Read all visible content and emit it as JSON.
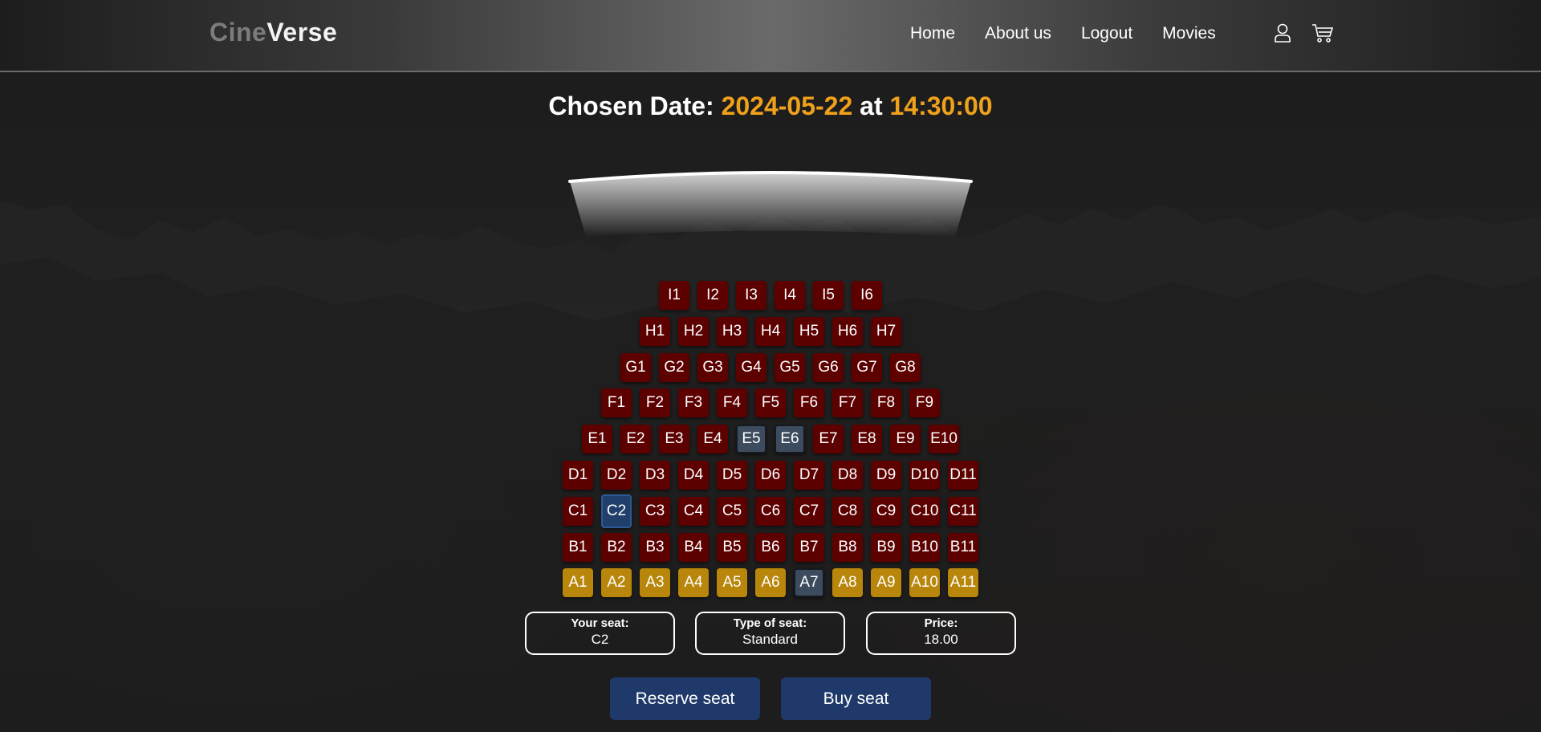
{
  "app": {
    "logo_part1": "Cine",
    "logo_part2": "Verse"
  },
  "nav": {
    "items": [
      "Home",
      "About us",
      "Logout",
      "Movies"
    ],
    "icons": [
      "user-icon",
      "cart-icon"
    ]
  },
  "heading": {
    "prefix": "Chosen Date:",
    "date": "2024-05-22",
    "connector": "at",
    "time": "14:30:00"
  },
  "colors": {
    "accent": "#f0a11a",
    "seat_available": "#5c0000",
    "seat_premium": "#b8860b",
    "seat_taken": "#3d4b5e",
    "seat_selected": "#203f6a",
    "button": "#1f3a6a"
  },
  "seating": {
    "rows": [
      {
        "row": "I",
        "seats": [
          {
            "label": "I1",
            "status": "available"
          },
          {
            "label": "I2",
            "status": "available"
          },
          {
            "label": "I3",
            "status": "available"
          },
          {
            "label": "I4",
            "status": "available"
          },
          {
            "label": "I5",
            "status": "available"
          },
          {
            "label": "I6",
            "status": "available"
          }
        ]
      },
      {
        "row": "H",
        "seats": [
          {
            "label": "H1",
            "status": "available"
          },
          {
            "label": "H2",
            "status": "available"
          },
          {
            "label": "H3",
            "status": "available"
          },
          {
            "label": "H4",
            "status": "available"
          },
          {
            "label": "H5",
            "status": "available"
          },
          {
            "label": "H6",
            "status": "available"
          },
          {
            "label": "H7",
            "status": "available"
          }
        ]
      },
      {
        "row": "G",
        "seats": [
          {
            "label": "G1",
            "status": "available"
          },
          {
            "label": "G2",
            "status": "available"
          },
          {
            "label": "G3",
            "status": "available"
          },
          {
            "label": "G4",
            "status": "available"
          },
          {
            "label": "G5",
            "status": "available"
          },
          {
            "label": "G6",
            "status": "available"
          },
          {
            "label": "G7",
            "status": "available"
          },
          {
            "label": "G8",
            "status": "available"
          }
        ]
      },
      {
        "row": "F",
        "seats": [
          {
            "label": "F1",
            "status": "available"
          },
          {
            "label": "F2",
            "status": "available"
          },
          {
            "label": "F3",
            "status": "available"
          },
          {
            "label": "F4",
            "status": "available"
          },
          {
            "label": "F5",
            "status": "available"
          },
          {
            "label": "F6",
            "status": "available"
          },
          {
            "label": "F7",
            "status": "available"
          },
          {
            "label": "F8",
            "status": "available"
          },
          {
            "label": "F9",
            "status": "available"
          }
        ]
      },
      {
        "row": "E",
        "seats": [
          {
            "label": "E1",
            "status": "available"
          },
          {
            "label": "E2",
            "status": "available"
          },
          {
            "label": "E3",
            "status": "available"
          },
          {
            "label": "E4",
            "status": "available"
          },
          {
            "label": "E5",
            "status": "taken"
          },
          {
            "label": "E6",
            "status": "taken"
          },
          {
            "label": "E7",
            "status": "available"
          },
          {
            "label": "E8",
            "status": "available"
          },
          {
            "label": "E9",
            "status": "available"
          },
          {
            "label": "E10",
            "status": "available"
          }
        ]
      },
      {
        "row": "D",
        "seats": [
          {
            "label": "D1",
            "status": "available"
          },
          {
            "label": "D2",
            "status": "available"
          },
          {
            "label": "D3",
            "status": "available"
          },
          {
            "label": "D4",
            "status": "available"
          },
          {
            "label": "D5",
            "status": "available"
          },
          {
            "label": "D6",
            "status": "available"
          },
          {
            "label": "D7",
            "status": "available"
          },
          {
            "label": "D8",
            "status": "available"
          },
          {
            "label": "D9",
            "status": "available"
          },
          {
            "label": "D10",
            "status": "available"
          },
          {
            "label": "D11",
            "status": "available"
          }
        ]
      },
      {
        "row": "C",
        "seats": [
          {
            "label": "C1",
            "status": "available"
          },
          {
            "label": "C2",
            "status": "selected"
          },
          {
            "label": "C3",
            "status": "available"
          },
          {
            "label": "C4",
            "status": "available"
          },
          {
            "label": "C5",
            "status": "available"
          },
          {
            "label": "C6",
            "status": "available"
          },
          {
            "label": "C7",
            "status": "available"
          },
          {
            "label": "C8",
            "status": "available"
          },
          {
            "label": "C9",
            "status": "available"
          },
          {
            "label": "C10",
            "status": "available"
          },
          {
            "label": "C11",
            "status": "available"
          }
        ]
      },
      {
        "row": "B",
        "seats": [
          {
            "label": "B1",
            "status": "available"
          },
          {
            "label": "B2",
            "status": "available"
          },
          {
            "label": "B3",
            "status": "available"
          },
          {
            "label": "B4",
            "status": "available"
          },
          {
            "label": "B5",
            "status": "available"
          },
          {
            "label": "B6",
            "status": "available"
          },
          {
            "label": "B7",
            "status": "available"
          },
          {
            "label": "B8",
            "status": "available"
          },
          {
            "label": "B9",
            "status": "available"
          },
          {
            "label": "B10",
            "status": "available"
          },
          {
            "label": "B11",
            "status": "available"
          }
        ]
      },
      {
        "row": "A",
        "seats": [
          {
            "label": "A1",
            "status": "premium"
          },
          {
            "label": "A2",
            "status": "premium"
          },
          {
            "label": "A3",
            "status": "premium"
          },
          {
            "label": "A4",
            "status": "premium"
          },
          {
            "label": "A5",
            "status": "premium"
          },
          {
            "label": "A6",
            "status": "premium"
          },
          {
            "label": "A7",
            "status": "taken"
          },
          {
            "label": "A8",
            "status": "premium"
          },
          {
            "label": "A9",
            "status": "premium"
          },
          {
            "label": "A10",
            "status": "premium"
          },
          {
            "label": "A11",
            "status": "premium"
          }
        ]
      }
    ]
  },
  "summary": {
    "seat_label": "Your seat:",
    "seat_value": "C2",
    "type_label": "Type of seat:",
    "type_value": "Standard",
    "price_label": "Price:",
    "price_value": "18.00"
  },
  "actions": {
    "reserve_label": "Reserve seat",
    "buy_label": "Buy seat"
  }
}
